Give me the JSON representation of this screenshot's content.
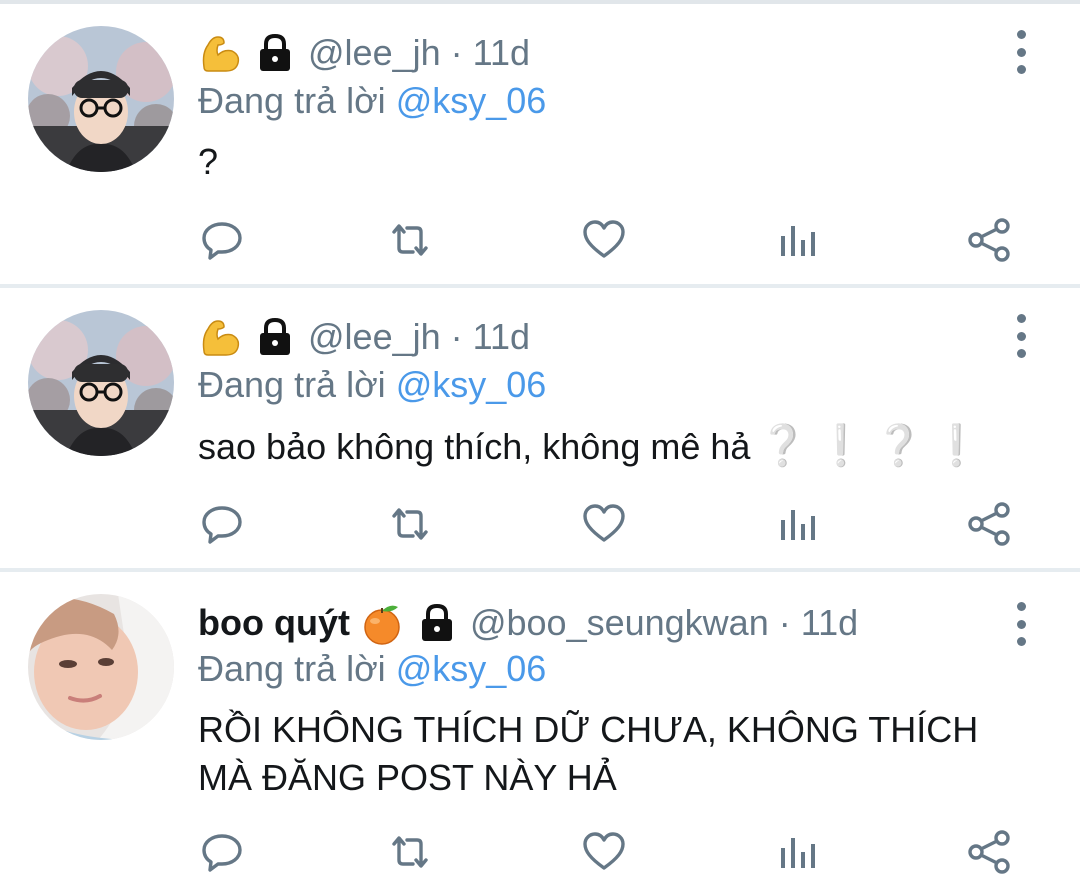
{
  "tweets": [
    {
      "display_name": "",
      "badge_emoji": "flexed-biceps",
      "locked": true,
      "handle": "@lee_jh",
      "separator": "·",
      "time": "11d",
      "reply_prefix": "Đang trả lời ",
      "reply_to": "@ksy_06",
      "text": "?",
      "avatar": "man-with-glasses-cherry-blossoms"
    },
    {
      "display_name": "",
      "badge_emoji": "flexed-biceps",
      "locked": true,
      "handle": "@lee_jh",
      "separator": "·",
      "time": "11d",
      "reply_prefix": "Đang trả lời ",
      "reply_to": "@ksy_06",
      "text": "sao bảo không thích, không mê hả",
      "text_trailing_emoji": [
        "❔",
        "❕",
        "❔",
        "❕"
      ],
      "avatar": "man-with-glasses-cherry-blossoms"
    },
    {
      "display_name": "boo quýt",
      "badge_emoji": "tangerine",
      "locked": true,
      "handle": "@boo_seungkwan",
      "separator": "·",
      "time": "11d",
      "reply_prefix": "Đang trả lời ",
      "reply_to": "@ksy_06",
      "text": "RỒI KHÔNG THÍCH DỮ CHƯA, KHÔNG THÍCH MÀ ĐĂNG POST NÀY HẢ",
      "avatar": "person-lying-on-pillow"
    }
  ],
  "actions": [
    "reply-icon",
    "retweet-icon",
    "like-icon",
    "analytics-icon",
    "share-icon"
  ],
  "colors": {
    "handle_gray": "#657786",
    "mention_blue": "#4a99e9",
    "icon_gray": "#657786",
    "divider": "#e6ecf0"
  }
}
